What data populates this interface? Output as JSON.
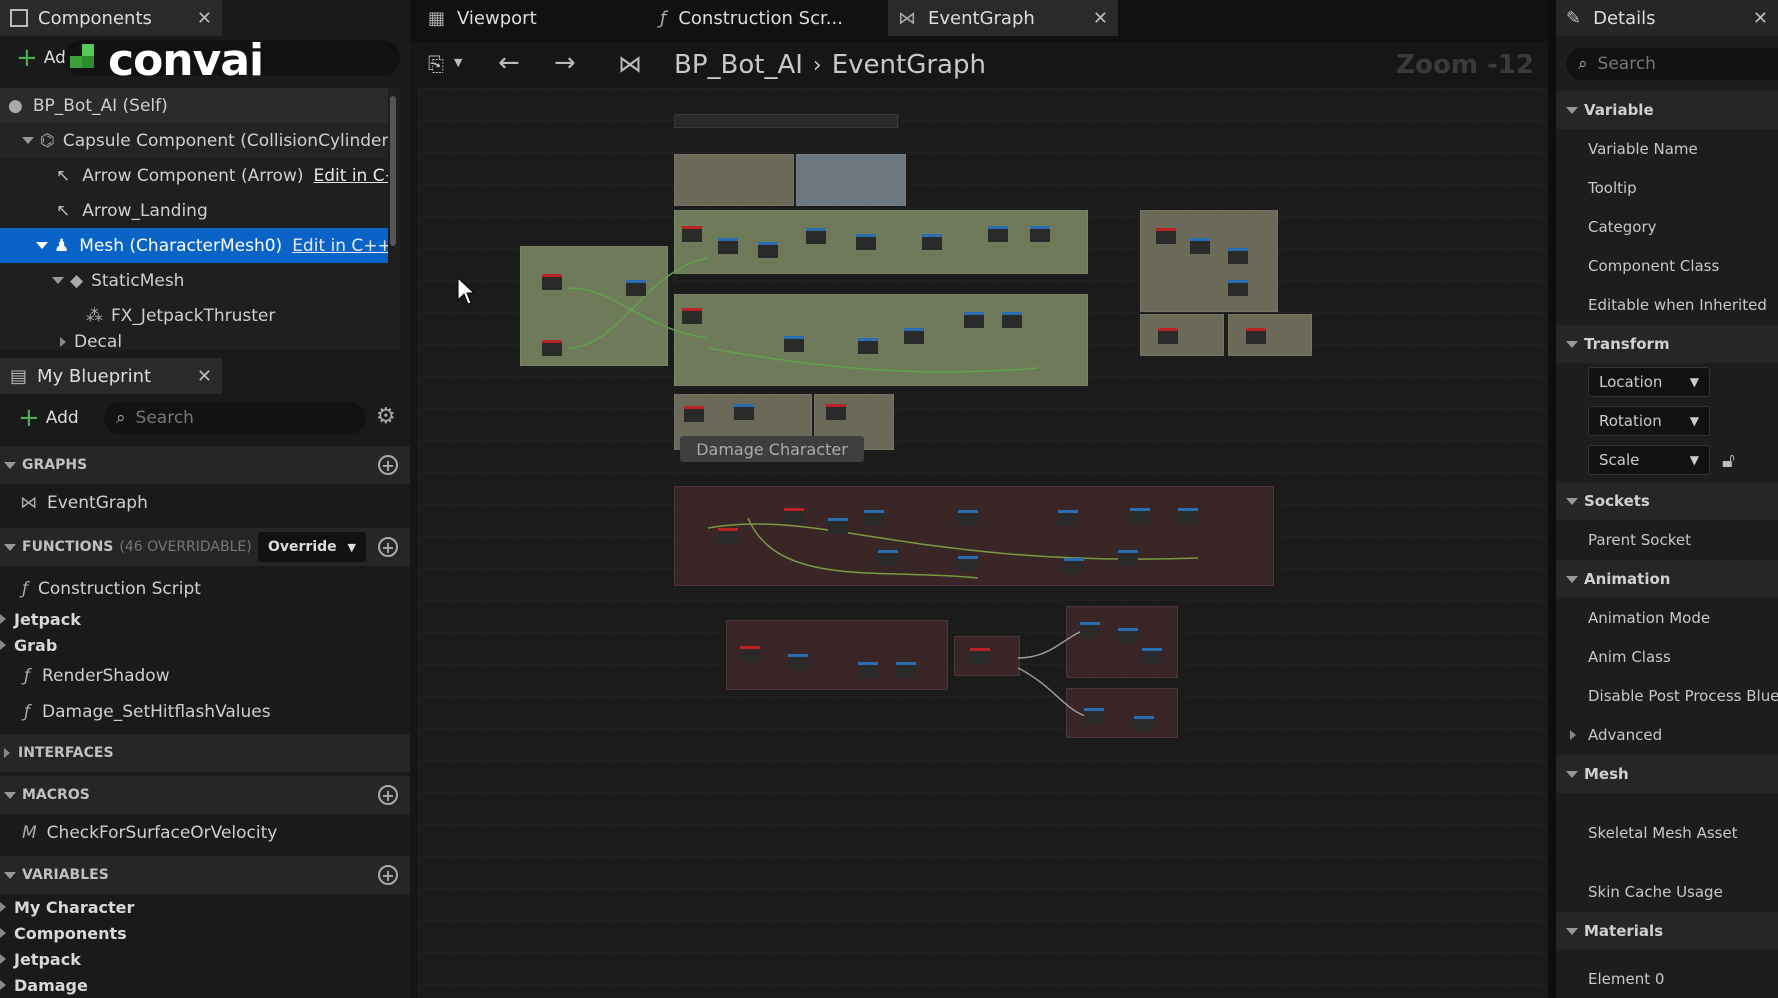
{
  "components_panel": {
    "tab_label": "Components",
    "add_label": "Add",
    "tree": [
      {
        "label": "BP_Bot_AI (Self)"
      },
      {
        "label": "Capsule Component (CollisionCylinder)"
      },
      {
        "label": "Arrow Component (Arrow)",
        "link": "Edit in C+"
      },
      {
        "label": "Arrow_Landing"
      },
      {
        "label": "Mesh (CharacterMesh0)",
        "link": "Edit in C++"
      },
      {
        "label": "StaticMesh"
      },
      {
        "label": "FX_JetpackThruster"
      },
      {
        "label": "Decal"
      }
    ]
  },
  "logo_text": "convai",
  "my_blueprint": {
    "tab_label": "My Blueprint",
    "add_label": "Add",
    "search_placeholder": "Search",
    "graphs_label": "GRAPHS",
    "graphs": [
      "EventGraph"
    ],
    "functions_label": "FUNCTIONS",
    "functions_overridable": "(46 OVERRIDABLE)",
    "override_label": "Override",
    "functions": [
      "Construction Script"
    ],
    "function_categories": [
      "Jetpack",
      "Grab"
    ],
    "functions_more": [
      "RenderShadow",
      "Damage_SetHitflashValues"
    ],
    "interfaces_label": "INTERFACES",
    "macros_label": "MACROS",
    "macros": [
      "CheckForSurfaceOrVelocity"
    ],
    "variables_label": "VARIABLES",
    "variable_categories": [
      "My Character",
      "Components",
      "Jetpack",
      "Damage"
    ]
  },
  "editor_tabs": [
    {
      "label": "Viewport"
    },
    {
      "label": "Construction Scr..."
    },
    {
      "label": "EventGraph"
    }
  ],
  "breadcrumb": {
    "root": "BP_Bot_AI",
    "current": "EventGraph"
  },
  "zoom_label": "Zoom -12",
  "graph": {
    "comment_label": "Damage Character"
  },
  "details": {
    "tab_label": "Details",
    "search_placeholder": "Search",
    "sections": {
      "variable": "Variable",
      "transform": "Transform",
      "sockets": "Sockets",
      "animation": "Animation",
      "advanced": "Advanced",
      "mesh": "Mesh",
      "materials": "Materials"
    },
    "variable_rows": [
      "Variable Name",
      "Tooltip",
      "Category",
      "Component Class",
      "Editable when Inherited"
    ],
    "transform_dropdowns": [
      "Location",
      "Rotation",
      "Scale"
    ],
    "sockets_rows": [
      "Parent Socket"
    ],
    "animation_rows": [
      "Animation Mode",
      "Anim Class",
      "Disable Post Process Blue"
    ],
    "mesh_rows": [
      "Skeletal Mesh Asset",
      "Skin Cache Usage"
    ],
    "materials_rows": [
      "Element 0"
    ]
  },
  "colors": {
    "selection": "#0a64c8",
    "comment_green": "#6f7a5a",
    "comment_red": "#3a2626"
  }
}
